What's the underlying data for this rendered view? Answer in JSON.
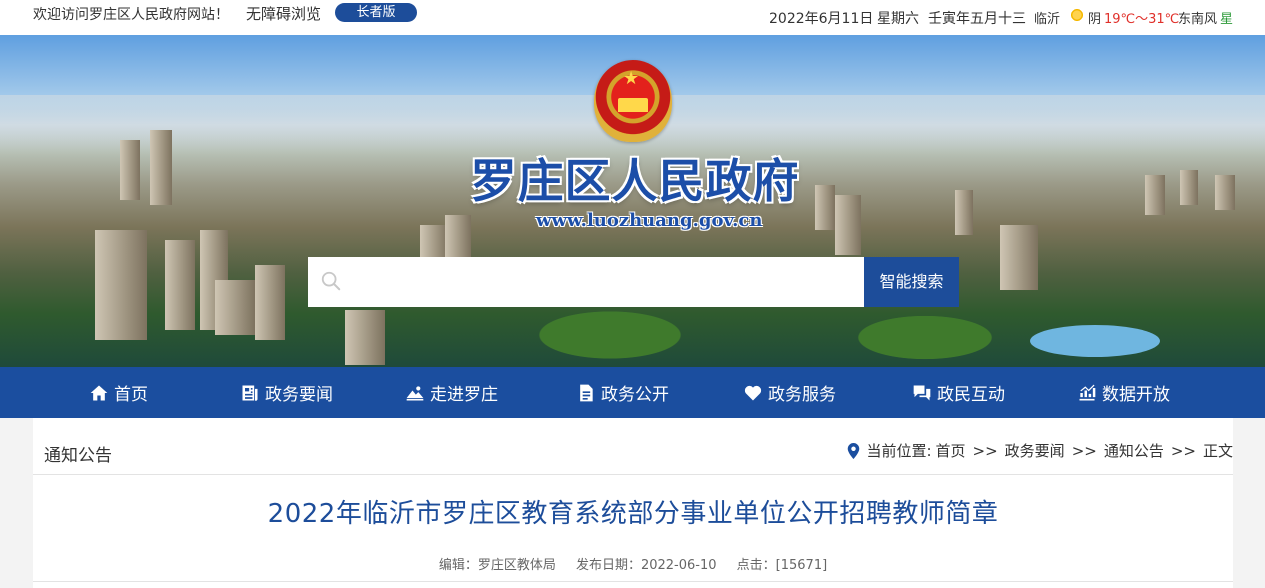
{
  "topbar": {
    "welcome": "欢迎访问罗庄区人民政府网站！",
    "accessibility_label": "无障碍浏览",
    "elder_mode_label": "长者版",
    "date": "2022年6月11日",
    "weekday": "星期六",
    "lunar_date": "壬寅年五月十三",
    "city": "临沂",
    "weather_icon": "sun-cloud-icon",
    "weather": "阴",
    "temperature": "19℃～31℃",
    "wind": "东南风",
    "wind_level_partial": "星"
  },
  "banner": {
    "site_title": "罗庄区人民政府",
    "site_url": "www.luozhuang.gov.cn",
    "emblem_icon": "national-emblem-icon",
    "search": {
      "placeholder": "",
      "button_label": "智能搜索"
    }
  },
  "nav": {
    "items": [
      {
        "label": "首页",
        "icon": "home-icon"
      },
      {
        "label": "政务要闻",
        "icon": "newspaper-icon"
      },
      {
        "label": "走进罗庄",
        "icon": "landscape-icon"
      },
      {
        "label": "政务公开",
        "icon": "document-icon"
      },
      {
        "label": "政务服务",
        "icon": "heart-icon"
      },
      {
        "label": "政民互动",
        "icon": "chat-icon"
      },
      {
        "label": "数据开放",
        "icon": "chart-icon"
      }
    ]
  },
  "content": {
    "section_title": "通知公告",
    "breadcrumb": {
      "prefix": "当前位置:",
      "items": [
        "首页",
        "政务要闻",
        "通知公告",
        "正文"
      ],
      "separator": ">>"
    },
    "article": {
      "title": "2022年临沂市罗庄区教育系统部分事业单位公开招聘教师简章",
      "editor": "编辑：罗庄区教体局",
      "publish_date": "发布日期：2022-06-10",
      "clicks": "点击：[15671]"
    }
  },
  "colors": {
    "primary_blue": "#1b4e9f",
    "title_blue": "#1d4d9a",
    "temperature_red": "#e0302a"
  }
}
